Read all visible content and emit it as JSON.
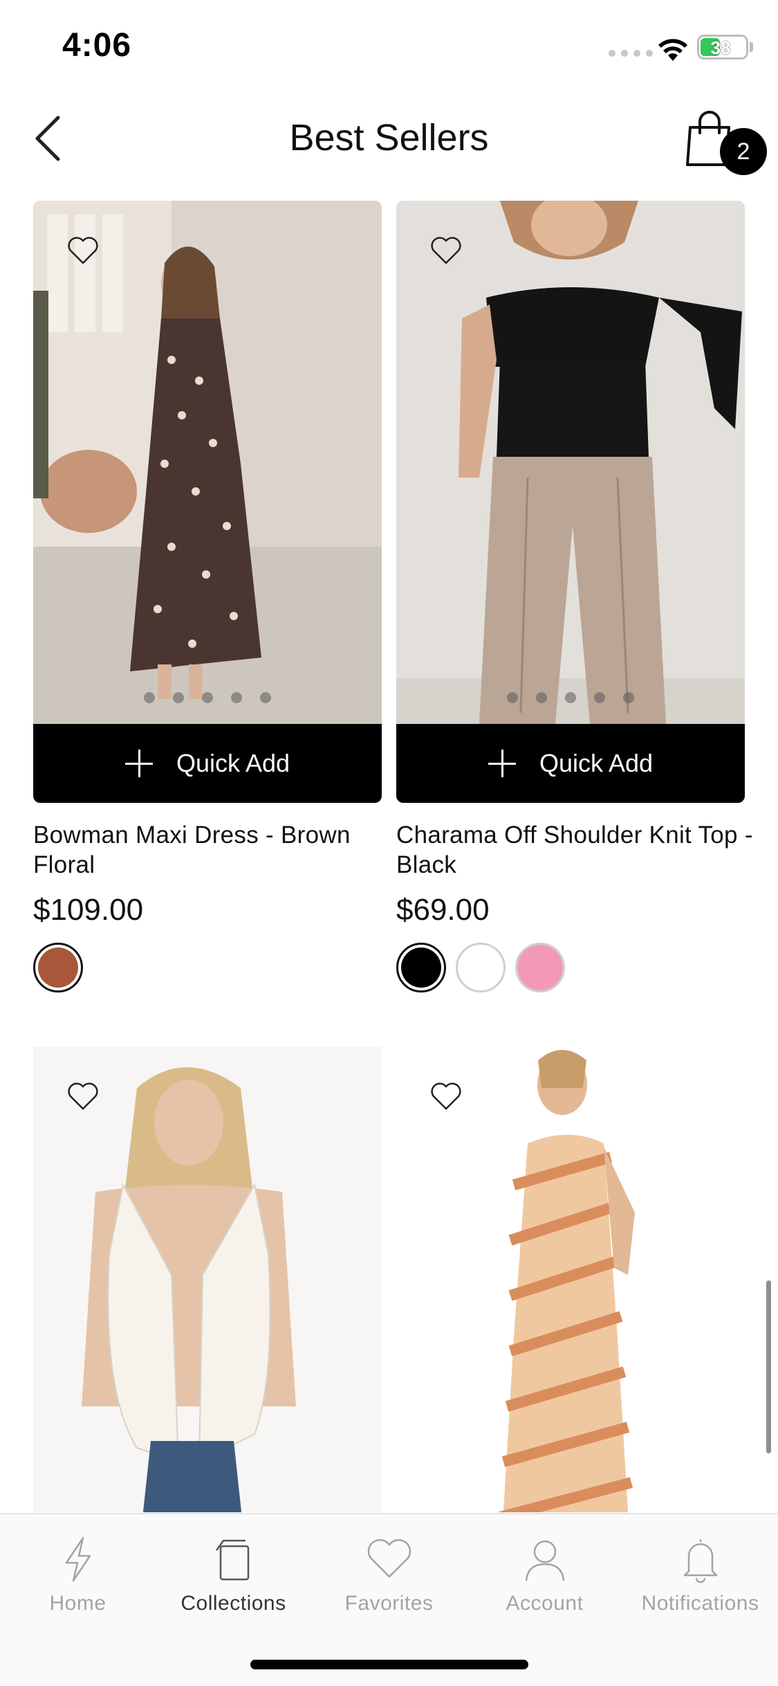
{
  "status_bar": {
    "time": "4:06",
    "battery": "38"
  },
  "header": {
    "title": "Best Sellers",
    "back_icon": "chevron-left-icon",
    "cart_icon": "shopping-bag-icon",
    "cart_count": "2"
  },
  "products": [
    {
      "name": "Bowman Maxi Dress - Brown Floral",
      "price": "$109.00",
      "quick_add": "Quick Add",
      "image": "woman in brown floral maxi dress",
      "swatches": [
        "#a8573a"
      ],
      "selected_swatch": 0
    },
    {
      "name": "Charama Off Shoulder Knit Top - Black",
      "price": "$69.00",
      "quick_add": "Quick Add",
      "image": "woman in black off-shoulder top and beige trousers",
      "swatches": [
        "#000000",
        "#ffffff",
        "#f29ab5"
      ],
      "selected_swatch": 0
    },
    {
      "image": "woman in white tie-front vest top"
    },
    {
      "image": "woman in peach striped maxi dress"
    }
  ],
  "tab_bar": {
    "items": [
      {
        "label": "Home",
        "icon": "lightning-icon",
        "active": false
      },
      {
        "label": "Collections",
        "icon": "collections-icon",
        "active": true
      },
      {
        "label": "Favorites",
        "icon": "heart-icon",
        "active": false
      },
      {
        "label": "Account",
        "icon": "person-icon",
        "active": false
      },
      {
        "label": "Notifications",
        "icon": "bell-icon",
        "active": false
      }
    ]
  },
  "colors": {
    "accent": "#000000",
    "inactive_tab": "#a4a4a4"
  }
}
